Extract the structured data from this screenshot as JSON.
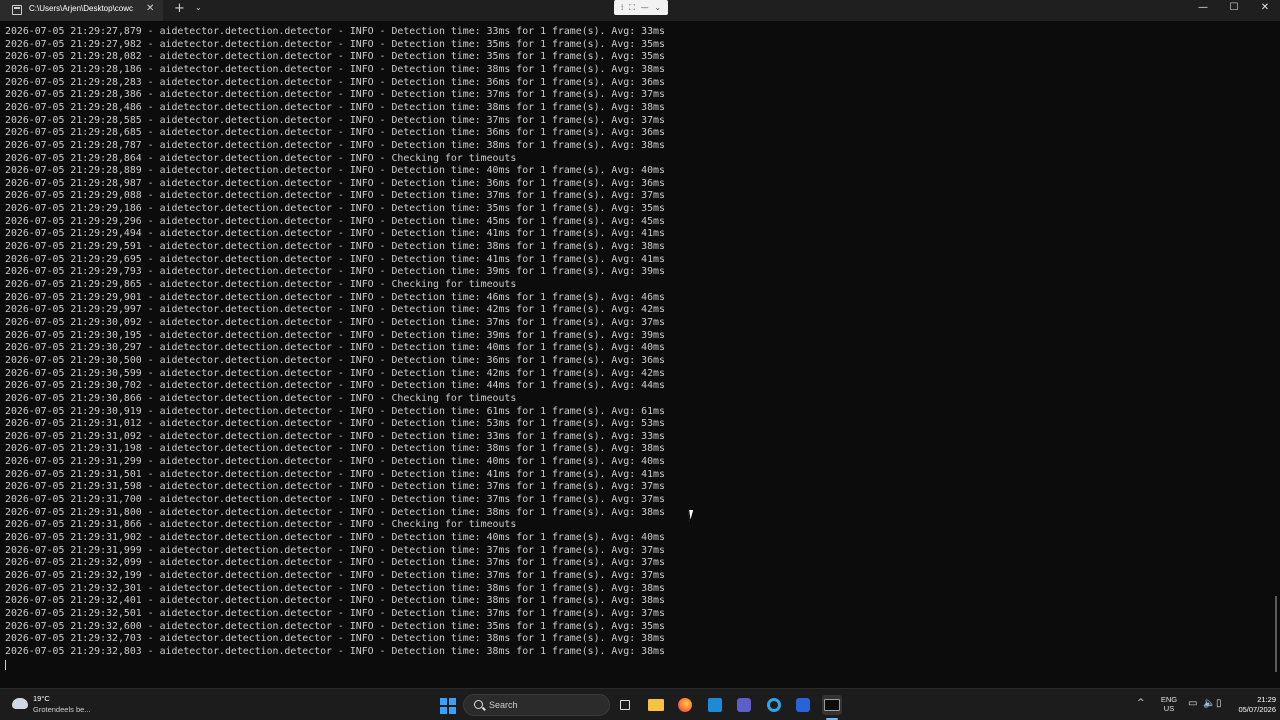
{
  "window": {
    "tab_title": "C:\\Users\\Arjen\\Desktop\\cowc",
    "close_glyph": "✕",
    "new_tab_glyph": "+",
    "dropdown_glyph": "⌄",
    "minimize_glyph": "—",
    "maximize_glyph": "☐",
    "window_close_glyph": "✕",
    "toolbar_glyphs": [
      "⁞",
      "⛶",
      "—",
      "⌄"
    ]
  },
  "terminal": {
    "lines": [
      "2026-07-05 21:29:27,879 - aidetector.detection.detector - INFO - Detection time: 33ms for 1 frame(s). Avg: 33ms",
      "2026-07-05 21:29:27,982 - aidetector.detection.detector - INFO - Detection time: 35ms for 1 frame(s). Avg: 35ms",
      "2026-07-05 21:29:28,082 - aidetector.detection.detector - INFO - Detection time: 35ms for 1 frame(s). Avg: 35ms",
      "2026-07-05 21:29:28,186 - aidetector.detection.detector - INFO - Detection time: 38ms for 1 frame(s). Avg: 38ms",
      "2026-07-05 21:29:28,283 - aidetector.detection.detector - INFO - Detection time: 36ms for 1 frame(s). Avg: 36ms",
      "2026-07-05 21:29:28,386 - aidetector.detection.detector - INFO - Detection time: 37ms for 1 frame(s). Avg: 37ms",
      "2026-07-05 21:29:28,486 - aidetector.detection.detector - INFO - Detection time: 38ms for 1 frame(s). Avg: 38ms",
      "2026-07-05 21:29:28,585 - aidetector.detection.detector - INFO - Detection time: 37ms for 1 frame(s). Avg: 37ms",
      "2026-07-05 21:29:28,685 - aidetector.detection.detector - INFO - Detection time: 36ms for 1 frame(s). Avg: 36ms",
      "2026-07-05 21:29:28,787 - aidetector.detection.detector - INFO - Detection time: 38ms for 1 frame(s). Avg: 38ms",
      "2026-07-05 21:29:28,864 - aidetector.detection.detector - INFO - Checking for timeouts",
      "2026-07-05 21:29:28,889 - aidetector.detection.detector - INFO - Detection time: 40ms for 1 frame(s). Avg: 40ms",
      "2026-07-05 21:29:28,987 - aidetector.detection.detector - INFO - Detection time: 36ms for 1 frame(s). Avg: 36ms",
      "2026-07-05 21:29:29,088 - aidetector.detection.detector - INFO - Detection time: 37ms for 1 frame(s). Avg: 37ms",
      "2026-07-05 21:29:29,186 - aidetector.detection.detector - INFO - Detection time: 35ms for 1 frame(s). Avg: 35ms",
      "2026-07-05 21:29:29,296 - aidetector.detection.detector - INFO - Detection time: 45ms for 1 frame(s). Avg: 45ms",
      "2026-07-05 21:29:29,494 - aidetector.detection.detector - INFO - Detection time: 41ms for 1 frame(s). Avg: 41ms",
      "2026-07-05 21:29:29,591 - aidetector.detection.detector - INFO - Detection time: 38ms for 1 frame(s). Avg: 38ms",
      "2026-07-05 21:29:29,695 - aidetector.detection.detector - INFO - Detection time: 41ms for 1 frame(s). Avg: 41ms",
      "2026-07-05 21:29:29,793 - aidetector.detection.detector - INFO - Detection time: 39ms for 1 frame(s). Avg: 39ms",
      "2026-07-05 21:29:29,865 - aidetector.detection.detector - INFO - Checking for timeouts",
      "2026-07-05 21:29:29,901 - aidetector.detection.detector - INFO - Detection time: 46ms for 1 frame(s). Avg: 46ms",
      "2026-07-05 21:29:29,997 - aidetector.detection.detector - INFO - Detection time: 42ms for 1 frame(s). Avg: 42ms",
      "2026-07-05 21:29:30,092 - aidetector.detection.detector - INFO - Detection time: 37ms for 1 frame(s). Avg: 37ms",
      "2026-07-05 21:29:30,195 - aidetector.detection.detector - INFO - Detection time: 39ms for 1 frame(s). Avg: 39ms",
      "2026-07-05 21:29:30,297 - aidetector.detection.detector - INFO - Detection time: 40ms for 1 frame(s). Avg: 40ms",
      "2026-07-05 21:29:30,500 - aidetector.detection.detector - INFO - Detection time: 36ms for 1 frame(s). Avg: 36ms",
      "2026-07-05 21:29:30,599 - aidetector.detection.detector - INFO - Detection time: 42ms for 1 frame(s). Avg: 42ms",
      "2026-07-05 21:29:30,702 - aidetector.detection.detector - INFO - Detection time: 44ms for 1 frame(s). Avg: 44ms",
      "2026-07-05 21:29:30,866 - aidetector.detection.detector - INFO - Checking for timeouts",
      "2026-07-05 21:29:30,919 - aidetector.detection.detector - INFO - Detection time: 61ms for 1 frame(s). Avg: 61ms",
      "2026-07-05 21:29:31,012 - aidetector.detection.detector - INFO - Detection time: 53ms for 1 frame(s). Avg: 53ms",
      "2026-07-05 21:29:31,092 - aidetector.detection.detector - INFO - Detection time: 33ms for 1 frame(s). Avg: 33ms",
      "2026-07-05 21:29:31,198 - aidetector.detection.detector - INFO - Detection time: 38ms for 1 frame(s). Avg: 38ms",
      "2026-07-05 21:29:31,299 - aidetector.detection.detector - INFO - Detection time: 40ms for 1 frame(s). Avg: 40ms",
      "2026-07-05 21:29:31,501 - aidetector.detection.detector - INFO - Detection time: 41ms for 1 frame(s). Avg: 41ms",
      "2026-07-05 21:29:31,598 - aidetector.detection.detector - INFO - Detection time: 37ms for 1 frame(s). Avg: 37ms",
      "2026-07-05 21:29:31,700 - aidetector.detection.detector - INFO - Detection time: 37ms for 1 frame(s). Avg: 37ms",
      "2026-07-05 21:29:31,800 - aidetector.detection.detector - INFO - Detection time: 38ms for 1 frame(s). Avg: 38ms",
      "2026-07-05 21:29:31,866 - aidetector.detection.detector - INFO - Checking for timeouts",
      "2026-07-05 21:29:31,902 - aidetector.detection.detector - INFO - Detection time: 40ms for 1 frame(s). Avg: 40ms",
      "2026-07-05 21:29:31,999 - aidetector.detection.detector - INFO - Detection time: 37ms for 1 frame(s). Avg: 37ms",
      "2026-07-05 21:29:32,099 - aidetector.detection.detector - INFO - Detection time: 37ms for 1 frame(s). Avg: 37ms",
      "2026-07-05 21:29:32,199 - aidetector.detection.detector - INFO - Detection time: 37ms for 1 frame(s). Avg: 37ms",
      "2026-07-05 21:29:32,301 - aidetector.detection.detector - INFO - Detection time: 38ms for 1 frame(s). Avg: 38ms",
      "2026-07-05 21:29:32,401 - aidetector.detection.detector - INFO - Detection time: 38ms for 1 frame(s). Avg: 38ms",
      "2026-07-05 21:29:32,501 - aidetector.detection.detector - INFO - Detection time: 37ms for 1 frame(s). Avg: 37ms",
      "2026-07-05 21:29:32,600 - aidetector.detection.detector - INFO - Detection time: 35ms for 1 frame(s). Avg: 35ms",
      "2026-07-05 21:29:32,703 - aidetector.detection.detector - INFO - Detection time: 38ms for 1 frame(s). Avg: 38ms",
      "2026-07-05 21:29:32,803 - aidetector.detection.detector - INFO - Detection time: 38ms for 1 frame(s). Avg: 38ms"
    ]
  },
  "taskbar": {
    "weather_temp": "19°C",
    "weather_desc": "Grotendeels be...",
    "search_label": "Search",
    "tray_chevron": "^",
    "lang_top": "ENG",
    "lang_bottom": "US",
    "time": "21:29",
    "date": "05/07/2026",
    "net_glyph": "▭",
    "vol_glyph": "🔈",
    "bat_glyph": "▯"
  },
  "colors": {
    "terminal_bg": "#0c0c0c",
    "terminal_fg": "#cccccc",
    "accent": "#3aa0ff"
  }
}
